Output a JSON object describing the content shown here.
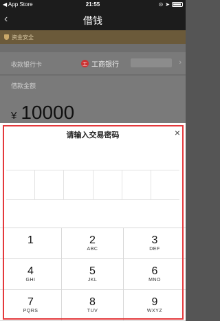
{
  "status": {
    "back_app": "◀ App Store",
    "time": "21:55",
    "icons": [
      "signal-icon",
      "wifi-icon",
      "lock-rotation-icon",
      "location-icon",
      "battery-icon"
    ]
  },
  "nav": {
    "title": "借钱",
    "back_glyph": "‹"
  },
  "safe_bar": {
    "text": "资金安全"
  },
  "bank_row": {
    "label": "收款银行卡",
    "bank_logo_glyph": "工",
    "bank_name": "工商银行",
    "chevron": "›"
  },
  "amount_row": {
    "label": "借款金额",
    "currency": "¥",
    "value": "10000"
  },
  "modal": {
    "title": "请输入交易密码",
    "close_glyph": "×",
    "password_digits": 6
  },
  "keypad": {
    "keys": [
      {
        "num": "1",
        "letters": ""
      },
      {
        "num": "2",
        "letters": "ABC"
      },
      {
        "num": "3",
        "letters": "DEF"
      },
      {
        "num": "4",
        "letters": "GHI"
      },
      {
        "num": "5",
        "letters": "JKL"
      },
      {
        "num": "6",
        "letters": "MNO"
      },
      {
        "num": "7",
        "letters": "PQRS"
      },
      {
        "num": "8",
        "letters": "TUV"
      },
      {
        "num": "9",
        "letters": "WXYZ"
      }
    ]
  },
  "colors": {
    "highlight_frame": "#e4393c",
    "nav_bg": "#1c1c1c",
    "safe_bar_bg": "#6b5a3a"
  }
}
